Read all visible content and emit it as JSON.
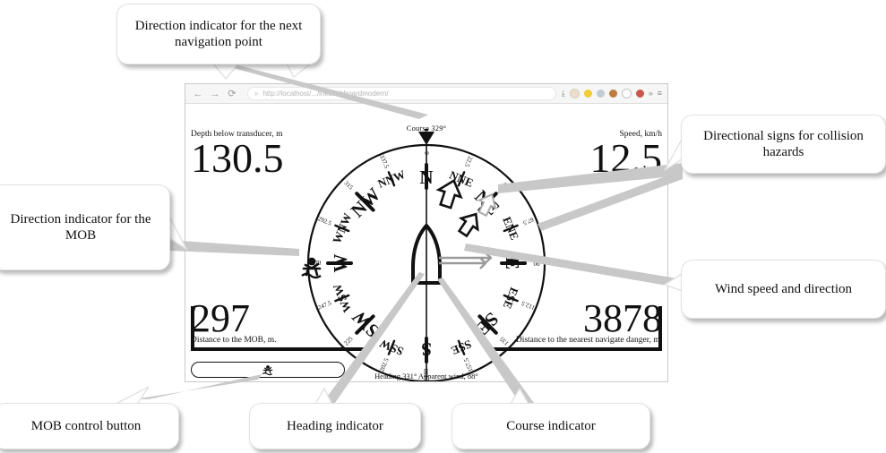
{
  "browser": {
    "back_icon": "back-arrow-icon",
    "forward_icon": "forward-arrow-icon",
    "reload_icon": "reload-icon",
    "back_glyph": "←",
    "forward_glyph": "→",
    "reload_glyph": "⟳",
    "search_glyph": "⌕",
    "url": "http://localhost/.../inkdashboardmodern/",
    "download_glyph": "⤓",
    "overflow_glyph": "»",
    "menu_glyph": "≡",
    "extension_colors": [
      "#e8d9c8",
      "#f0c419",
      "#b8c4cc",
      "#b5651d",
      "#ffffff",
      "#c0392b"
    ]
  },
  "dashboard": {
    "course_label": "Course 329°",
    "status_line": "Heading 331°     Apparent wind, 88°",
    "depth": {
      "label": "Depth below transducer, m",
      "value": "130.5"
    },
    "speed": {
      "label": "Speed, km/h",
      "value": "12.5"
    },
    "mob_distance": {
      "label": "Distance to the MOB, m.",
      "value": "297"
    },
    "danger_distance": {
      "label": "Distance to the nearest navigate danger, m.",
      "value": "3878"
    },
    "mob_button": {
      "name": "mob-control-button",
      "icon": "man-overboard-swimmer-icon"
    }
  },
  "compass": {
    "cardinals": [
      {
        "label": "N",
        "deg": 0
      },
      {
        "label": "NNE",
        "deg": 22.5
      },
      {
        "label": "NE",
        "deg": 45
      },
      {
        "label": "ENE",
        "deg": 67.5
      },
      {
        "label": "E",
        "deg": 90
      },
      {
        "label": "ESE",
        "deg": 112.5
      },
      {
        "label": "SE",
        "deg": 135
      },
      {
        "label": "SSE",
        "deg": 157.5
      },
      {
        "label": "S",
        "deg": 180
      },
      {
        "label": "SSW",
        "deg": 202.5
      },
      {
        "label": "SW",
        "deg": 225
      },
      {
        "label": "WSW",
        "deg": 247.5
      },
      {
        "label": "W",
        "deg": 270
      },
      {
        "label": "WNW",
        "deg": 292.5
      },
      {
        "label": "NW",
        "deg": 315
      },
      {
        "label": "NNW",
        "deg": 337.5
      }
    ],
    "degree_ticks": [
      "0",
      "22.5",
      "45",
      "67.5",
      "90",
      "112.5",
      "135",
      "157.5",
      "180",
      "202.5",
      "225",
      "247.5",
      "270",
      "292.5",
      "315",
      "337.5"
    ],
    "heading_deg": 0,
    "course_deg": 0,
    "waypoint_deg": 0,
    "mob_deg": 262,
    "wind_deg": 88,
    "hazard_degs": [
      8,
      26,
      40
    ],
    "vessel_icon": "boat-hull-icon",
    "mob_marker_icon": "man-overboard-swimmer-icon",
    "course_marker_icon": "course-triangle-icon",
    "wind_arrow_icon": "wind-direction-arrow-icon",
    "hazard_icon": "collision-hazard-chevron-icon"
  },
  "callouts": [
    {
      "id": "waypoint",
      "text": "Direction indicator for the next navigation point"
    },
    {
      "id": "hazards",
      "text": "Directional signs for collision hazards"
    },
    {
      "id": "mobdir",
      "text": "Direction indicator for the MOB"
    },
    {
      "id": "wind",
      "text": "Wind speed and direction"
    },
    {
      "id": "mobbutton",
      "text": "MOB control button"
    },
    {
      "id": "heading",
      "text": "Heading indicator"
    },
    {
      "id": "course",
      "text": "Course indicator"
    }
  ],
  "colors": {
    "ink": "#111111",
    "callout_border": "#e2e2e2",
    "chrome": "#f6f6f7"
  }
}
